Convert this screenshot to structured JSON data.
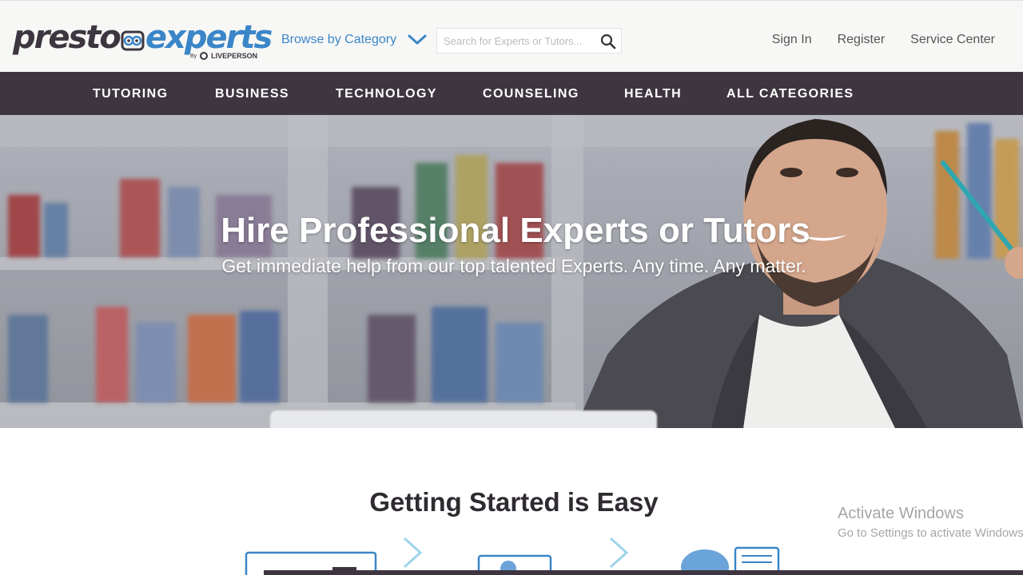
{
  "header": {
    "logo": {
      "part1": "presto",
      "part2": "experts",
      "by": "By",
      "partner": "LIVEPERSON"
    },
    "browse_label": "Browse by Category",
    "search": {
      "placeholder": "Search for Experts or Tutors...",
      "value": ""
    },
    "links": {
      "sign_in": "Sign In",
      "register": "Register",
      "service_center": "Service Center"
    }
  },
  "nav": {
    "items": [
      "TUTORING",
      "BUSINESS",
      "TECHNOLOGY",
      "COUNSELING",
      "HEALTH",
      "ALL CATEGORIES"
    ]
  },
  "hero": {
    "title": "Hire Professional Experts or Tutors",
    "subtitle": "Get immediate help from our top talented Experts. Any time. Any matter."
  },
  "getting_started": {
    "title": "Getting Started is Easy"
  },
  "os_watermark": {
    "line1": "Activate Windows",
    "line2": "Go to Settings to activate Windows."
  },
  "colors": {
    "brand_dark": "#3e3540",
    "brand_blue": "#3a86c8",
    "header_bg": "#f7f7f5"
  }
}
